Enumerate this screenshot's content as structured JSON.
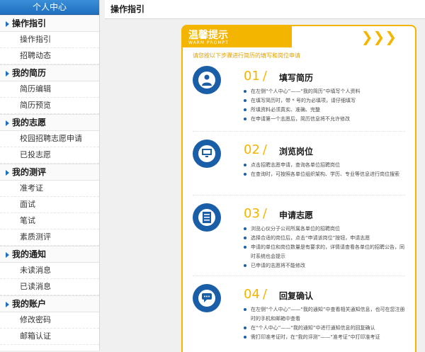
{
  "sidebar": {
    "title": "个人中心",
    "sections": [
      {
        "label": "操作指引",
        "items": [
          "操作指引",
          "招聘动态"
        ]
      },
      {
        "label": "我的简历",
        "items": [
          "简历编辑",
          "简历预览"
        ]
      },
      {
        "label": "我的志愿",
        "items": [
          "校园招聘志愿申请",
          "已投志愿"
        ]
      },
      {
        "label": "我的测评",
        "items": [
          "准考证",
          "面试",
          "笔试",
          "素质测评"
        ]
      },
      {
        "label": "我的通知",
        "items": [
          "未读消息",
          "已读消息"
        ]
      },
      {
        "label": "我的账户",
        "items": [
          "修改密码",
          "邮箱认证"
        ]
      }
    ]
  },
  "main": {
    "header": "操作指引",
    "panel": {
      "title": "温馨提示",
      "title_en": "WARM PROMPT",
      "chevrons": "❯❯❯",
      "subtitle": "请您按以下步骤进行简历的填写和岗位申请",
      "steps": [
        {
          "num": "01",
          "title": "填写简历",
          "icon": "person-icon",
          "lines": [
            "在左侧“个人中心”——“我的简历”中填写个人资料",
            "在填写简历时，带 * 号的为必填项，请仔细填写",
            "所填资料必须真实、准确、完整",
            "在申请第一个志愿后，简历信息将不允许修改"
          ]
        },
        {
          "num": "02",
          "title": "浏览岗位",
          "icon": "monitor-icon",
          "lines": [
            "点击招聘志愿申请，查询各单位招聘岗位",
            "在查询时，可按照各单位组织架构、学历、专业等信息进行岗位搜索"
          ]
        },
        {
          "num": "03",
          "title": "申请志愿",
          "icon": "document-icon",
          "lines": [
            "浏览心仪分子公司所属各单位的招聘岗位",
            "选择合适的岗位后，点击“申请该岗位”按钮，申请志愿",
            "申请的单位和岗位数量是有要求的，详情请查看各单位的招聘公告，同时系统也会提示",
            "已申请的志愿将不能修改"
          ]
        },
        {
          "num": "04",
          "title": "回复确认",
          "icon": "chat-icon",
          "lines": [
            "在左侧“个人中心”——“我的通知”中查看相关通知信息，也可在您注册时的手机和邮箱中查看",
            "在“个人中心”——“我的通知”中进行通知信息的回复确认",
            "需打印准考证时，在“我的评测”——“准考证”中打印准考证"
          ]
        }
      ]
    }
  },
  "colors": {
    "accent": "#f3b500",
    "blue": "#1a5ea8",
    "side_header": "#1f6fbf"
  }
}
